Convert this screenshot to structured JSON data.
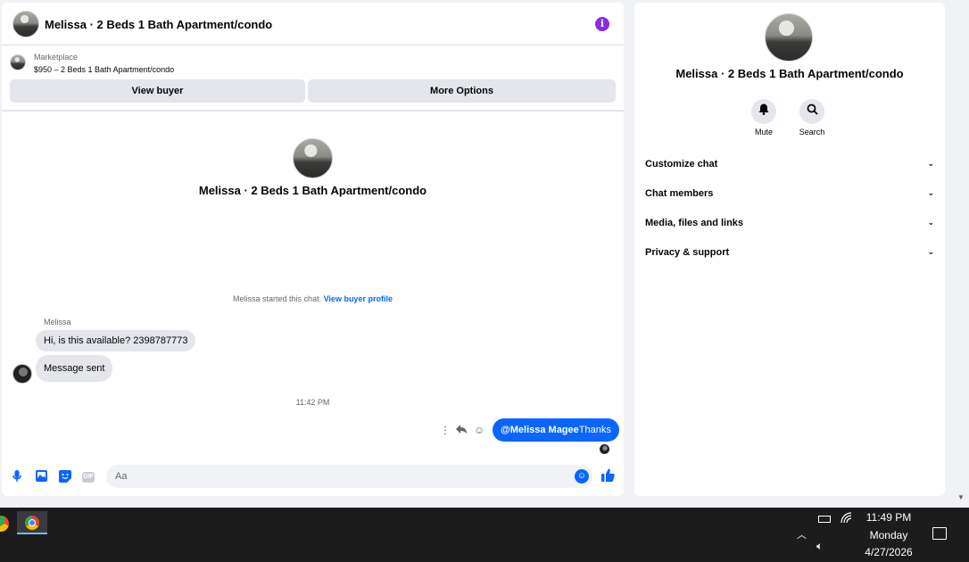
{
  "chat": {
    "title": "Melissa · 2 Beds 1 Bath Apartment/condo",
    "marketplace_label": "Marketplace",
    "listing": "$950 – 2 Beds 1 Bath Apartment/condo",
    "view_buyer": "View buyer",
    "more_options": "More Options",
    "intro_name": "Melissa · 2 Beds 1 Bath Apartment/condo",
    "started_text": "Melissa started this chat.",
    "view_buyer_profile": "View buyer profile",
    "sender_name": "Melissa",
    "messages_in": [
      "Hi, is this available? 2398787773",
      "Message sent"
    ],
    "timestamp": "11:42 PM",
    "outgoing_mention": "@Melissa Magee",
    "outgoing_text": "Thanks",
    "composer_placeholder": "Aa",
    "gif_label": "GIF"
  },
  "info": {
    "name": "Melissa · 2 Beds 1 Bath Apartment/condo",
    "mute_label": "Mute",
    "search_label": "Search",
    "sections": [
      "Customize chat",
      "Chat members",
      "Media, files and links",
      "Privacy & support"
    ]
  },
  "taskbar": {
    "time": "11:49 PM",
    "day": "Monday",
    "date": "4/27/2026"
  },
  "colors": {
    "accent": "#0866ff",
    "info_icon": "#8a2be2"
  },
  "icons": [
    "info-icon",
    "mic-icon",
    "image-icon",
    "sticker-icon",
    "gif-icon",
    "emoji-icon",
    "like-icon",
    "bell-icon",
    "search-icon",
    "chevron-down-icon",
    "reply-icon",
    "react-icon",
    "more-icon",
    "battery-icon",
    "wifi-icon",
    "volume-icon",
    "notification-icon"
  ]
}
